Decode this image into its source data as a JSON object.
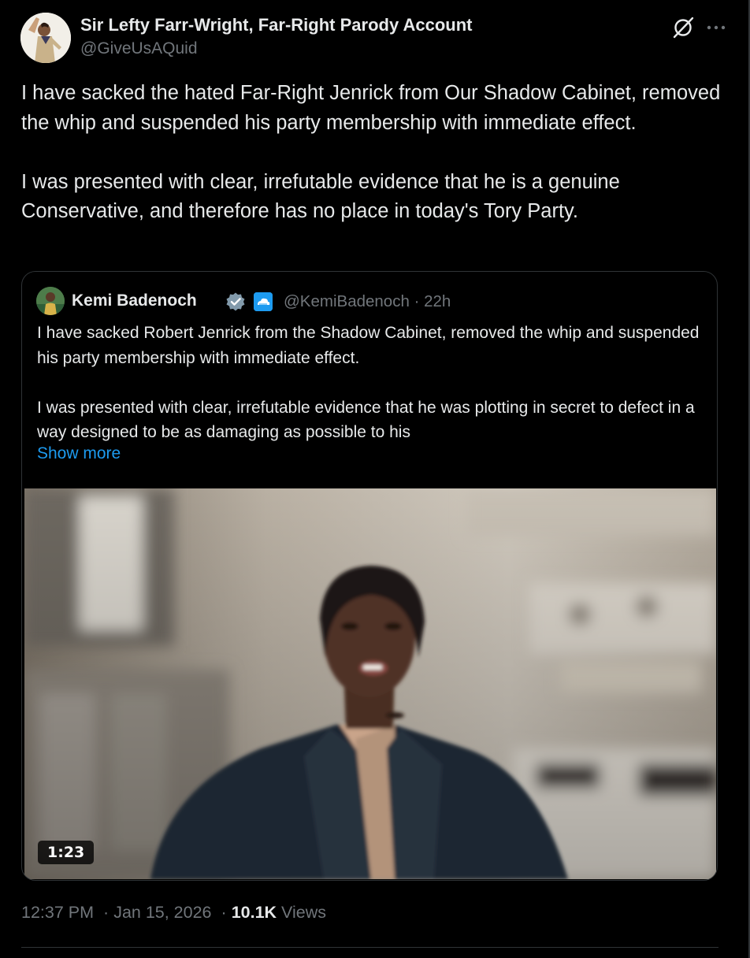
{
  "post": {
    "author": {
      "name": "Sir Lefty Farr-Wright, Far-Right Parody Account",
      "handle": "@GiveUsAQuid",
      "avatar_icon": "avatar-photo"
    },
    "header_icons": {
      "grok": "grok-icon",
      "more": "more-options-icon"
    },
    "text": {
      "paragraph_1": "I have sacked the hated Far-Right Jenrick from Our Shadow Cabinet, removed the whip and suspended his party membership with immediate effect.",
      "paragraph_2": "I was presented with clear, irrefutable evidence that he is a genuine Conservative, and therefore has no place in today's Tory Party."
    },
    "quote": {
      "author_name": "Kemi Badenoch",
      "handle": "@KemiBadenoch",
      "separator": "·",
      "time": "22h",
      "verified_icon": "verified-badge-icon",
      "affiliate_icon": "affiliate-badge-icon",
      "text": {
        "paragraph_1": "I have sacked Robert Jenrick from the Shadow Cabinet, removed the whip and suspended his party membership with immediate effect.",
        "paragraph_2": "I was presented with clear, irrefutable evidence that he was plotting in secret to defect in a way designed to be as damaging as possible to his"
      },
      "show_more": "Show more",
      "video": {
        "duration": "1:23"
      }
    },
    "footer": {
      "time": "12:37 PM",
      "separator_1": "·",
      "date": "Jan 15, 2026",
      "separator_2": "·",
      "views_count": "10.1K",
      "views_label": "Views"
    }
  },
  "colors": {
    "background": "#000000",
    "text_primary": "#e7e9ea",
    "text_secondary": "#71767b",
    "link": "#1d9bf0",
    "border": "#2f3336"
  }
}
